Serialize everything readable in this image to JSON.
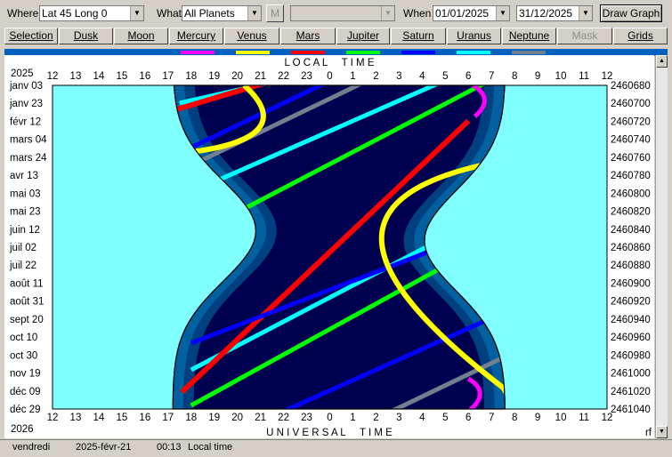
{
  "toolbar": {
    "where_label": "Where",
    "where_value": "Lat 45 Long 0",
    "what_label": "What",
    "what_value": "All Planets",
    "m_button": "M",
    "extra_value": "",
    "when_label": "When",
    "date_from": "01/01/2025",
    "date_to": "31/12/2025",
    "draw_button": "Draw Graph"
  },
  "planet_buttons": [
    {
      "label": "Selection"
    },
    {
      "label": "Dusk"
    },
    {
      "label": "Moon"
    },
    {
      "label": "Mercury"
    },
    {
      "label": "Venus"
    },
    {
      "label": "Mars"
    },
    {
      "label": "Jupiter"
    },
    {
      "label": "Saturn"
    },
    {
      "label": "Uranus"
    },
    {
      "label": "Neptune"
    },
    {
      "label": "Mask"
    },
    {
      "label": "Grids"
    }
  ],
  "legend_colors": {
    "mercury": "#ff00ff",
    "venus": "#ffff00",
    "mars": "#ff0000",
    "jupiter": "#00ff00",
    "saturn": "#0000ff",
    "uranus": "#00ffff",
    "neptune": "#708090"
  },
  "chart": {
    "year_top": "2025",
    "year_bottom": "2026",
    "title_top": "L O C A L     T I M E",
    "title_bottom": "U N I V E R S A L     T I M E",
    "corner_label": "rf",
    "hour_labels": [
      "12",
      "13",
      "14",
      "15",
      "16",
      "17",
      "18",
      "19",
      "20",
      "21",
      "22",
      "23",
      "0",
      "1",
      "2",
      "3",
      "4",
      "5",
      "6",
      "7",
      "8",
      "9",
      "10",
      "11",
      "12"
    ],
    "date_labels": [
      "janv 03",
      "janv 23",
      "févr 12",
      "mars 04",
      "mars 24",
      "avr 13",
      "mai 03",
      "mai 23",
      "juin 12",
      "juil 02",
      "juil 22",
      "août 11",
      "août 31",
      "sept 20",
      "oct 10",
      "oct 30",
      "nov 19",
      "déc 09",
      "déc 29"
    ],
    "jd_labels": [
      "2460680",
      "2460700",
      "2460720",
      "2460740",
      "2460760",
      "2460780",
      "2460800",
      "2460820",
      "2460840",
      "2460860",
      "2460880",
      "2460900",
      "2460920",
      "2460940",
      "2460960",
      "2460980",
      "2461000",
      "2461020",
      "2461040"
    ],
    "colors": {
      "day": "#80ffff",
      "night": "#000050",
      "twilight1": "#0060a0",
      "twilight2": "#004080"
    }
  },
  "status": {
    "day": "vendredi",
    "date": "2025-févr-21",
    "time": "00:13",
    "mode": "Local time"
  }
}
